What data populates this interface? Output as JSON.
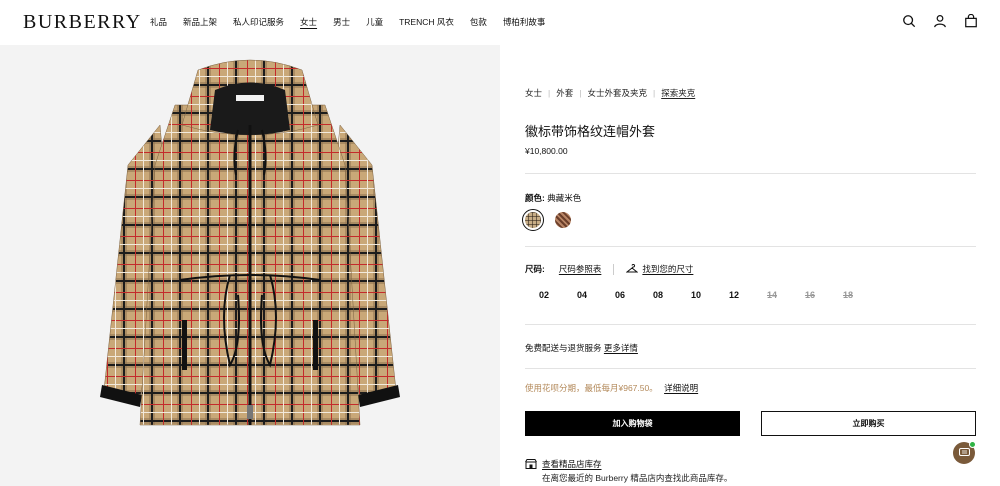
{
  "header": {
    "logo": "BURBERRY",
    "nav": [
      "礼品",
      "新品上架",
      "私人印记服务",
      "女士",
      "男士",
      "儿童",
      "TRENCH 风衣",
      "包款",
      "博柏利故事"
    ],
    "active_nav_index": 3,
    "icons": [
      "search-icon",
      "account-icon",
      "bag-icon"
    ]
  },
  "product": {
    "image_alt": "check-hooded-jacket-image",
    "breadcrumb": [
      "女士",
      "外套",
      "女士外套及夹克",
      "探索夹克"
    ],
    "title": "徽标带饰格纹连帽外套",
    "price": "¥10,800.00",
    "color_label": "颜色:",
    "color_value": "典藏米色",
    "swatches": [
      {
        "name": "archive-beige-check",
        "selected": true
      },
      {
        "name": "brown-check",
        "selected": false
      }
    ],
    "size_label": "尺码:",
    "size_guide": "尺码参照表",
    "find_size": "找到您的尺寸",
    "sizes": [
      {
        "label": "02",
        "available": true
      },
      {
        "label": "04",
        "available": true
      },
      {
        "label": "06",
        "available": true
      },
      {
        "label": "08",
        "available": true
      },
      {
        "label": "10",
        "available": true
      },
      {
        "label": "12",
        "available": true
      },
      {
        "label": "14",
        "available": false
      },
      {
        "label": "16",
        "available": false
      },
      {
        "label": "18",
        "available": false
      }
    ],
    "shipping_text": "免费配送与退货服务",
    "shipping_link": "更多详情",
    "installment_text": "使用花呗分期，最低每月¥967.50。",
    "installment_link": "详细说明",
    "add_to_bag": "加入购物袋",
    "buy_now": "立即购买",
    "store_title": "查看精品店库存",
    "store_desc": "在离您最近的 Burberry 精品店内查找此商品库存。"
  },
  "colors": {
    "accent_text": "#b3895a",
    "primary": "#000000",
    "panel_bg": "#f3f3f3"
  }
}
